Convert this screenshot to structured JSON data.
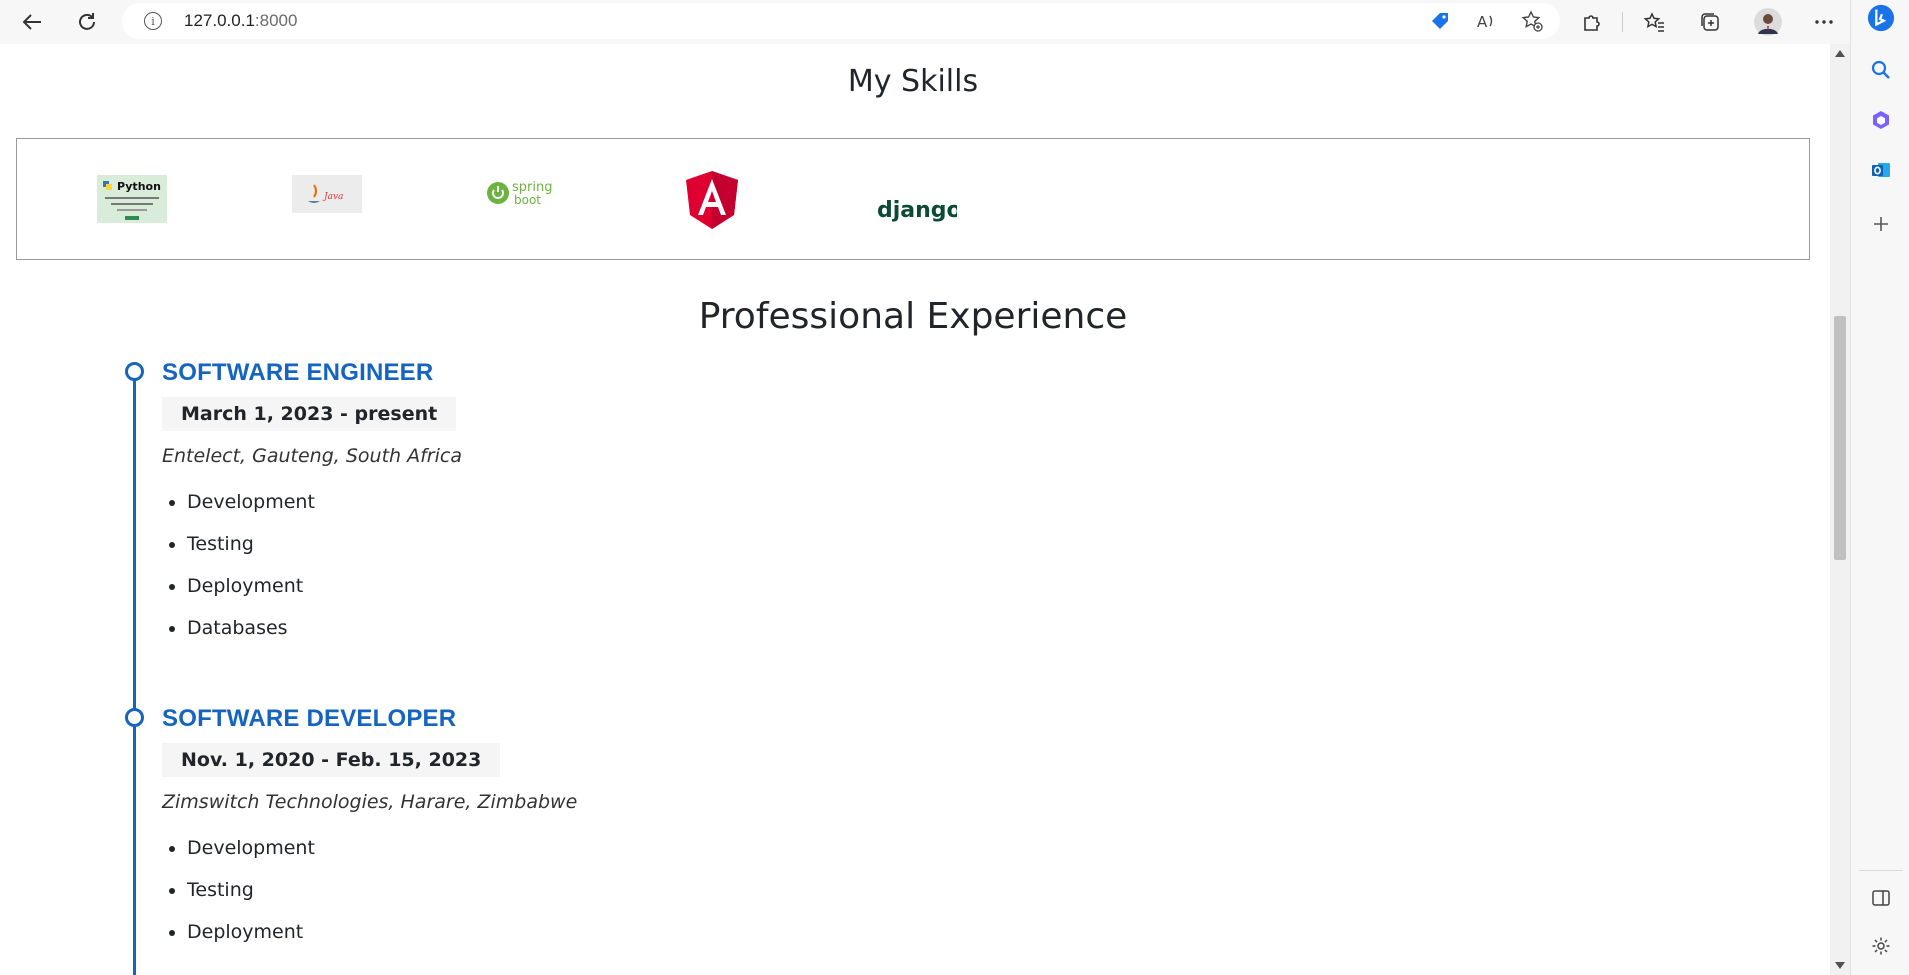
{
  "browser": {
    "url_host": "127.0.0.1",
    "url_port": ":8000",
    "info_glyph": "i"
  },
  "page": {
    "skills_title": "My Skills",
    "skills": [
      {
        "name": "Python",
        "icon": "python-logo"
      },
      {
        "name": "Java",
        "icon": "java-logo"
      },
      {
        "name": "spring boot",
        "icon": "spring-boot-logo"
      },
      {
        "name": "Angular",
        "icon": "angular-logo"
      },
      {
        "name": "django",
        "icon": "django-logo"
      }
    ],
    "experience_title": "Professional Experience",
    "jobs": [
      {
        "title": "SOFTWARE ENGINEER",
        "dates": "March 1, 2023 - present",
        "company": "Entelect, Gauteng, South Africa",
        "duties": [
          "Development",
          "Testing",
          "Deployment",
          "Databases"
        ]
      },
      {
        "title": "SOFTWARE DEVELOPER",
        "dates": "Nov. 1, 2020 - Feb. 15, 2023",
        "company": "Zimswitch Technologies, Harare, Zimbabwe",
        "duties": [
          "Development",
          "Testing",
          "Deployment"
        ]
      }
    ]
  },
  "colors": {
    "accent": "#1565c0",
    "angular_red": "#dd0031",
    "spring_green": "#6db33f",
    "django_green": "#0c4b33"
  }
}
